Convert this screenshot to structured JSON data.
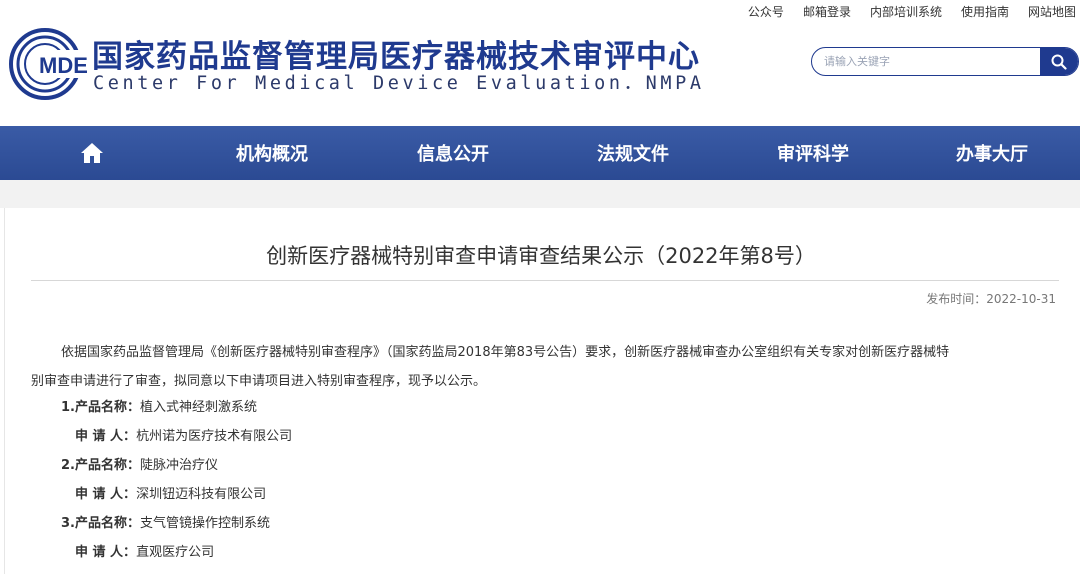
{
  "top_links": [
    "公众号",
    "邮箱登录",
    "内部培训系统",
    "使用指南",
    "网站地图"
  ],
  "logo": {
    "text": "MDE"
  },
  "site": {
    "title_cn": "国家药品监督管理局医疗器械技术审评中心",
    "title_en": "Center For Medical Device Evaluation．NMPA"
  },
  "search": {
    "placeholder": "请输入关键字"
  },
  "nav": {
    "home_icon": "home-icon",
    "items": [
      "机构概况",
      "信息公开",
      "法规文件",
      "审评科学",
      "办事大厅"
    ]
  },
  "article": {
    "title": "创新医疗器械特别审查申请审查结果公示（2022年第8号）",
    "date_label": "发布时间：",
    "date": "2022-10-31",
    "intro_line1": "依据国家药品监督管理局《创新医疗器械特别审查程序》（国家药监局2018年第83号公告）要求，创新医疗器械审查办公室组织有关专家对创新医疗器械特",
    "intro_line2": "别审查申请进行了审查，拟同意以下申请项目进入特别审查程序，现予以公示。",
    "items": [
      {
        "product_label": "1.产品名称：",
        "product": "植入式神经刺激系统",
        "applicant_label": "申 请 人：",
        "applicant": "杭州诺为医疗技术有限公司"
      },
      {
        "product_label": "2.产品名称：",
        "product": "陡脉冲治疗仪",
        "applicant_label": "申 请 人：",
        "applicant": "深圳钮迈科技有限公司"
      },
      {
        "product_label": "3.产品名称：",
        "product": "支气管镜操作控制系统",
        "applicant_label": "申 请 人：",
        "applicant": "直观医疗公司"
      }
    ]
  },
  "colors": {
    "brand": "#1f3a8f",
    "nav": "#2f4f9c"
  }
}
